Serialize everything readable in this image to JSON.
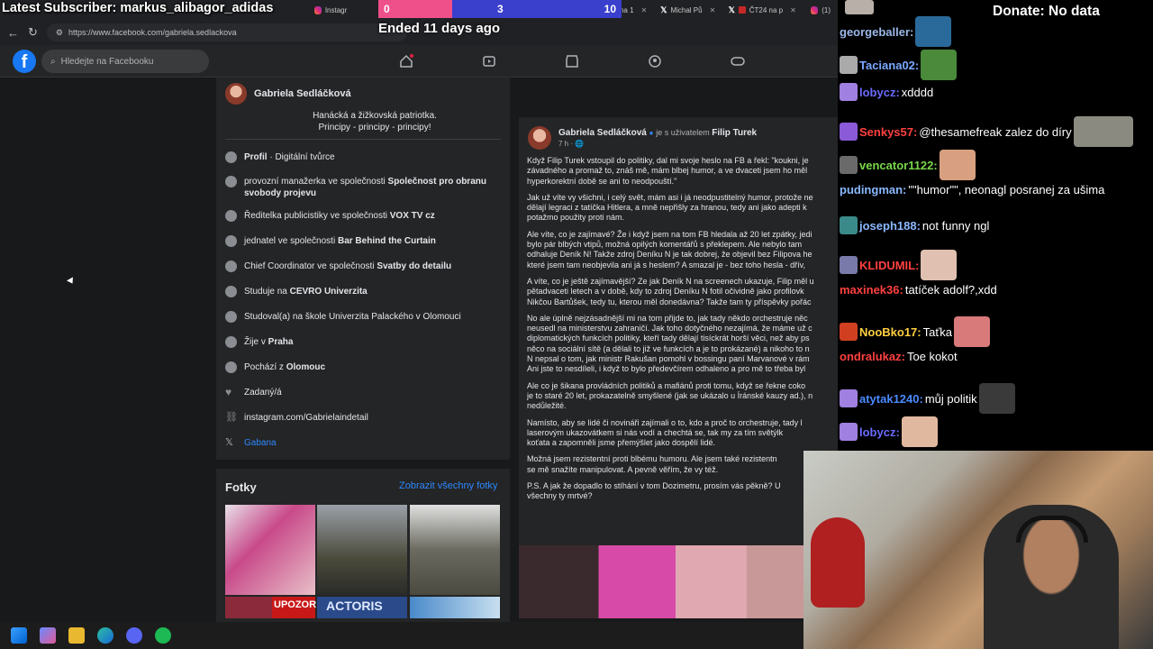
{
  "browser": {
    "tabs": [
      {
        "icon": "instagram-icon",
        "label": "Instagr"
      },
      {
        "icon": "x-icon",
        "label": "října 1"
      },
      {
        "icon": "x-icon",
        "label": "Michal Pů"
      },
      {
        "icon": "ct24-icon",
        "label": "ČT24 na p"
      },
      {
        "icon": "instagram-icon",
        "label": "(1)"
      }
    ],
    "url": "https://www.facebook.com/gabriela.sedlackova"
  },
  "overlay": {
    "subscriber": "Latest Subscriber: markus_alibagor_adidas",
    "vote_a": "0",
    "vote_b": "3",
    "vote_c": "10",
    "ended": "Ended 11 days ago",
    "donate": "Donate: No data"
  },
  "fb": {
    "search_placeholder": "Hledejte na Facebooku",
    "profile_name": "Gabriela Sedláčková",
    "bio_line1": "Hanácká a žižkovská patriotka.",
    "bio_line2": "Principy - principy - principy!",
    "intro": [
      {
        "icon": "info-icon",
        "pre": "",
        "bold": "Profil",
        "post": " · Digitální tvůrce"
      },
      {
        "icon": "work-icon",
        "pre": "provozní manažerka ve společnosti ",
        "bold": "Společnost pro obranu svobody projevu",
        "post": ""
      },
      {
        "icon": "work-icon",
        "pre": "Ředitelka publicistiky ve společnosti ",
        "bold": "VOX TV cz",
        "post": ""
      },
      {
        "icon": "work-icon",
        "pre": "jednatel ve společnosti ",
        "bold": "Bar Behind the Curtain",
        "post": ""
      },
      {
        "icon": "work-icon",
        "pre": "Chief Coordinator ve společnosti ",
        "bold": "Svatby do detailu",
        "post": ""
      },
      {
        "icon": "school-icon",
        "pre": "Studuje na ",
        "bold": "CEVRO Univerzita",
        "post": ""
      },
      {
        "icon": "school-icon",
        "pre": "Studoval(a) na škole ",
        "bold": "",
        "post": "Univerzita Palackého v Olomouci"
      },
      {
        "icon": "home-icon",
        "pre": "Žije v ",
        "bold": "Praha",
        "post": ""
      },
      {
        "icon": "pin-icon",
        "pre": "Pochází z ",
        "bold": "Olomouc",
        "post": ""
      },
      {
        "icon": "heart-icon",
        "pre": "Zadaný/á",
        "bold": "",
        "post": ""
      },
      {
        "icon": "link-icon",
        "pre": "instagram.com/Gabrielaindetail",
        "bold": "",
        "post": ""
      },
      {
        "icon": "x-icon",
        "pre": "Gabana",
        "bold": "",
        "post": ""
      }
    ],
    "photos_title": "Fotky",
    "photos_all": "Zobrazit všechny fotky",
    "photo_tag": "UPOZOR",
    "photo_tag2": "ACTORIS",
    "post": {
      "author": "Gabriela Sedláčková",
      "with": " je s uživatelem ",
      "with_name": "Filip Turek",
      "time": "7 h",
      "lines": [
        [
          "Když Filip Turek vstoupil do politiky, dal mi svoje heslo na FB a řekl: \"koukni, je",
          "závadného a promaž to, znáš mě, mám blbej humor, a ve dvaceti jsem ho měl",
          "hyperkorektní době se ani to neodpouští.\""
        ],
        [
          "Jak už víte vy všichni, i celý svět, mám asi i já neodpustitelný humor, protože ne",
          "dělají legraci z tatíčka Hitlera, a mně nepřišly za hranou, tedy ani jako adepti k",
          "potažmo použity proti nám."
        ],
        [
          "Ale víte, co je zajímavé? Že i když jsem na tom FB hledala až 20 let zpátky, jedi",
          "bylo pár blbých vtipů, možná opilých komentářů s překlepem. Ale nebylo tam",
          "odhaluje Deník N! Takže zdroj Deníku N je tak dobrej, že objevil bez Filipova he",
          "které jsem tam neobjevila ani já s heslem? A smazal je - bez toho hesla - dřív,"
        ],
        [
          "A víte, co je ještě zajímavější? Ze jak Deník N na screenech ukazuje, Filip měl u",
          "pětadvaceti letech a v době, kdy to zdroj Deníku N fotil očividně jako profilovk",
          "Nikčou Bartůšek, tedy tu, kterou měl donedávna? Takže tam ty příspěvky pořác"
        ],
        [
          "No ale úplně nejzásadnější mi na tom přijde to, jak tady někdo orchestruje něc",
          "neusedl na ministerstvu zahraničí. Jak toho dotyčného nezajímá, že máme už c",
          "diplomatických funkcích politiky, kteří tady dělají tisíckrát horší věci, než aby ps",
          "něco na sociální sítě (a dělali to již ve funkcích a je to prokázané) a nikoho to n",
          "N nepsal o tom, jak ministr Rakušan pomohl v bossingu paní Marvanové v rám",
          "Ani jste to nesdíleli, i když to bylo předevčírem odhaleno a pro mě to třeba byl"
        ],
        [
          "Ale co je šikana provládních politiků a mafiánů proti tomu, když se řekne coko",
          "je to staré 20 let, prokazatelně smyšlené (jak se ukázalo u Íránské kauzy ad.), n",
          "nedůležité."
        ],
        [
          "Namísto, aby se lidé či novináři zajímali o to, kdo a proč to orchestruje, tady l",
          "laserovým ukazovátkem si nás vodí a chechtá se, tak my za tím světýlk",
          "koťata a zapomněli jsme přemýšlet jako dospělí lidé."
        ],
        [
          "Možná jsem rezistentní proti blbému humoru. Ale jsem také rezistentn",
          "se mě snažíte manipulovat. A pevně věřím, že vy též."
        ],
        [
          "P.S. A jak že dopadlo to stíhání v tom Dozimetru, prosím vás pěkně? U",
          "všechny ty mrtvé?"
        ]
      ]
    }
  },
  "chat": [
    {
      "user": "georgeballer:",
      "color": "#9ab8e8",
      "text": "",
      "badge": "",
      "emote": "#2a6a9a"
    },
    {
      "user": "Taciana02:",
      "color": "#7aa8ff",
      "text": "",
      "badge": "#aaaaaa",
      "emote": "#4a8a3a"
    },
    {
      "user": "lobycz:",
      "color": "#6a6aff",
      "text": " xdddd",
      "badge": "#a080e0",
      "emote": ""
    },
    {
      "user": "Senkys57:",
      "color": "#ff4040",
      "text": " @thesamefreak zalez do díry",
      "badge": "#8a5ad8",
      "emote": "#8a8a80"
    },
    {
      "user": "vencator1122:",
      "color": "#7ad84a",
      "text": "",
      "badge": "#6a6a6a",
      "emote": "#d8a080"
    },
    {
      "user": "pudingman:",
      "color": "#8ab8ff",
      "text": " \"\"humor\"\", neonagl posranej za ušima",
      "badge": "",
      "emote": ""
    },
    {
      "user": "joseph188:",
      "color": "#8ab8ff",
      "text": " not funny ngl",
      "badge": "#3a8a8a",
      "emote": ""
    },
    {
      "user": "KLIDUMIL:",
      "color": "#ff4040",
      "text": "",
      "badge": "#7a7aaa",
      "emote": "#e0c0b0"
    },
    {
      "user": "maxinek36:",
      "color": "#ff4040",
      "text": " tatíček adolf?,xdd",
      "badge": "",
      "emote": ""
    },
    {
      "user": "NooBko17:",
      "color": "#ffd040",
      "text": " Taťka",
      "badge": "#d04020",
      "emote": "#d87a7a"
    },
    {
      "user": "ondralukaz:",
      "color": "#ff4040",
      "text": " Toe kokot",
      "badge": "",
      "emote": ""
    },
    {
      "user": "atytak1240:",
      "color": "#4a8aff",
      "text": " můj politik",
      "badge": "#a080e0",
      "emote": "#3a3a3a"
    },
    {
      "user": "lobycz:",
      "color": "#6a6aff",
      "text": "",
      "badge": "#a080e0",
      "emote": "#e0b8a0"
    }
  ]
}
